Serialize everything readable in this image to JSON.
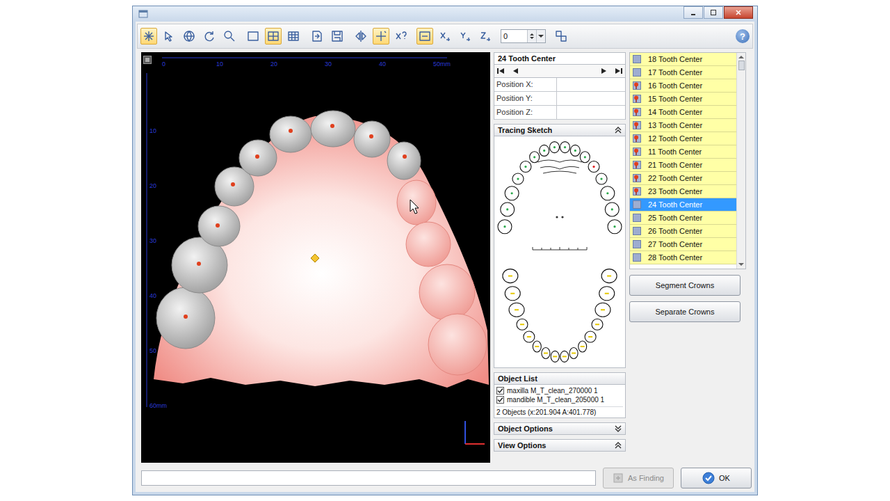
{
  "toolbar": {
    "groups": [
      [
        {
          "on": true
        },
        {
          "on": false
        },
        {
          "on": false
        },
        {
          "on": false
        },
        {
          "on": false
        }
      ],
      [
        {
          "on": false
        },
        {
          "on": true
        },
        {
          "on": false
        }
      ],
      [
        {
          "on": false
        },
        {
          "on": false
        }
      ],
      [
        {
          "on": false
        },
        {
          "on": true
        },
        {
          "on": false
        }
      ],
      [
        {
          "on": true
        },
        {
          "on": false
        },
        {
          "on": false
        },
        {
          "on": false
        }
      ],
      [
        {
          "on": false
        }
      ]
    ],
    "spin_value": "0",
    "help": "?"
  },
  "viewport": {
    "ruler_top": [
      "0",
      "10",
      "20",
      "30",
      "40",
      "50mm"
    ],
    "ruler_left": [
      "10",
      "20",
      "30",
      "40",
      "50",
      "60mm"
    ]
  },
  "point_panel": {
    "title": "24 Tooth Center",
    "fields": [
      {
        "label": "Position X:",
        "value": ""
      },
      {
        "label": "Position Y:",
        "value": ""
      },
      {
        "label": "Position Z:",
        "value": ""
      }
    ]
  },
  "tracing_sketch": {
    "title": "Tracing Sketch",
    "expanded": true
  },
  "object_list": {
    "title": "Object List",
    "items": [
      {
        "label": "maxilla M_T_clean_270000 1",
        "checked": true
      },
      {
        "label": "mandible M_T_clean_205000 1",
        "checked": true
      }
    ],
    "summary": "2 Objects (x:201.904 A:401.778)"
  },
  "sections": [
    {
      "title": "Object Options",
      "expanded": false
    },
    {
      "title": "View Options",
      "expanded": true
    }
  ],
  "landmarks": [
    {
      "label": "18 Tooth Center",
      "placed": false,
      "selected": false
    },
    {
      "label": "17 Tooth Center",
      "placed": false,
      "selected": false
    },
    {
      "label": "16 Tooth Center",
      "placed": true,
      "selected": false
    },
    {
      "label": "15 Tooth Center",
      "placed": true,
      "selected": false
    },
    {
      "label": "14 Tooth Center",
      "placed": true,
      "selected": false
    },
    {
      "label": "13 Tooth Center",
      "placed": true,
      "selected": false
    },
    {
      "label": "12 Tooth Center",
      "placed": true,
      "selected": false
    },
    {
      "label": "11 Tooth Center",
      "placed": true,
      "selected": false
    },
    {
      "label": "21 Tooth Center",
      "placed": true,
      "selected": false
    },
    {
      "label": "22 Tooth Center",
      "placed": true,
      "selected": false
    },
    {
      "label": "23 Tooth Center",
      "placed": true,
      "selected": false
    },
    {
      "label": "24 Tooth Center",
      "placed": false,
      "selected": true
    },
    {
      "label": "25 Tooth Center",
      "placed": false,
      "selected": false
    },
    {
      "label": "26 Tooth Center",
      "placed": false,
      "selected": false
    },
    {
      "label": "27 Tooth Center",
      "placed": false,
      "selected": false
    },
    {
      "label": "28 Tooth Center",
      "placed": false,
      "selected": false
    }
  ],
  "actions": [
    "Segment Crowns",
    "Separate Crowns"
  ],
  "footer": {
    "status": "",
    "buttons": [
      {
        "label": "As Finding",
        "disabled": true,
        "kind": "finding"
      },
      {
        "label": "OK",
        "disabled": false,
        "kind": "ok"
      }
    ]
  }
}
